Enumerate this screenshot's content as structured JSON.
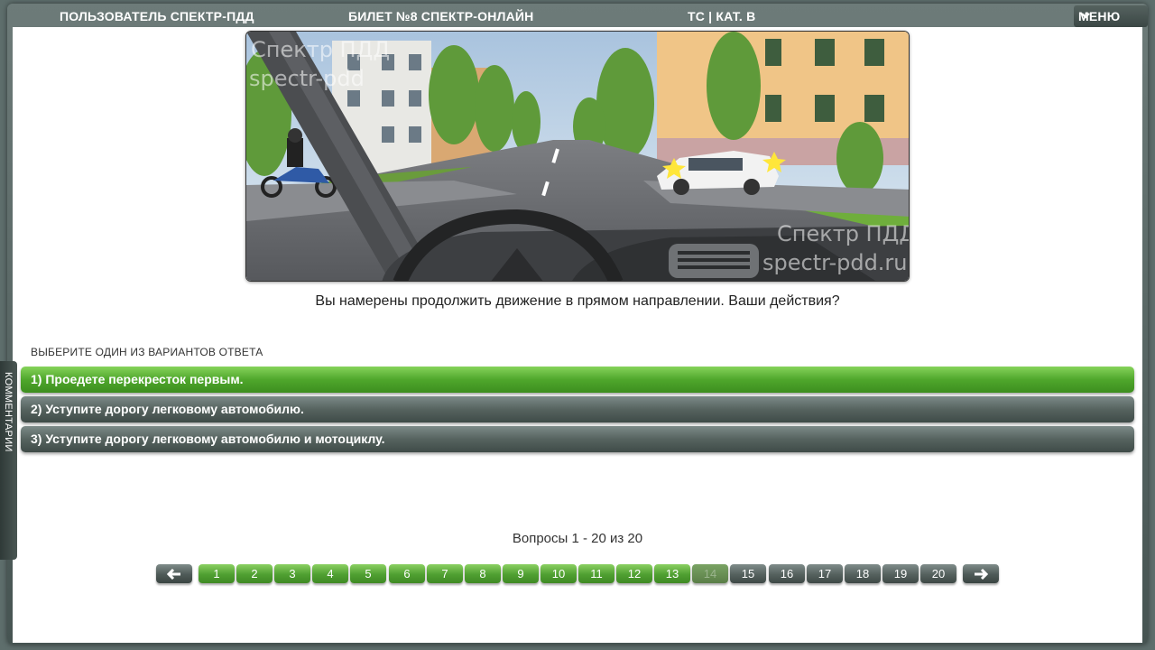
{
  "header": {
    "user": "ПОЛЬЗОВАТЕЛЬ СПЕКТР-ПДД",
    "ticket": "БИЛЕТ №8 СПЕКТР-ОНЛАЙН",
    "category": "ТС | КАТ. В",
    "menu_label": "МЕНЮ"
  },
  "scene": {
    "watermark_top_1": "Спектр ПДД",
    "watermark_top_2": "spectr-pdd",
    "watermark_bottom_1": "Спектр ПДД",
    "watermark_bottom_2": "spectr-pdd.ru"
  },
  "question": {
    "text": "Вы намерены продолжить движение в прямом направлении. Ваши действия?",
    "hint": "ВЫБЕРИТЕ ОДИН ИЗ ВАРИАНТОВ ОТВЕТА"
  },
  "answers": [
    {
      "label": "1) Проедете перекресток первым.",
      "highlighted": true
    },
    {
      "label": "2) Уступите дорогу легковому автомобилю.",
      "highlighted": false
    },
    {
      "label": "3) Уступите дорогу легковому автомобилю и мотоциклу.",
      "highlighted": false
    }
  ],
  "sidebar": {
    "comments_label": "КОММЕНТАРИИ"
  },
  "pagination": {
    "info": "Вопросы 1 - 20 из 20",
    "current_page": 14,
    "pages": [
      {
        "label": "1",
        "state": "answered"
      },
      {
        "label": "2",
        "state": "answered"
      },
      {
        "label": "3",
        "state": "answered"
      },
      {
        "label": "4",
        "state": "answered"
      },
      {
        "label": "5",
        "state": "answered"
      },
      {
        "label": "6",
        "state": "answered"
      },
      {
        "label": "7",
        "state": "answered"
      },
      {
        "label": "8",
        "state": "answered"
      },
      {
        "label": "9",
        "state": "answered"
      },
      {
        "label": "10",
        "state": "answered"
      },
      {
        "label": "11",
        "state": "answered"
      },
      {
        "label": "12",
        "state": "answered"
      },
      {
        "label": "13",
        "state": "answered"
      },
      {
        "label": "14",
        "state": "current"
      },
      {
        "label": "15",
        "state": "unanswered"
      },
      {
        "label": "16",
        "state": "unanswered"
      },
      {
        "label": "17",
        "state": "unanswered"
      },
      {
        "label": "18",
        "state": "unanswered"
      },
      {
        "label": "19",
        "state": "unanswered"
      },
      {
        "label": "20",
        "state": "unanswered"
      }
    ],
    "prev_icon": "arrow-left-icon",
    "next_icon": "arrow-right-icon"
  },
  "colors": {
    "answered": "#4f9f31",
    "unanswered": "#55615e",
    "highlight": "#4fa72c"
  }
}
